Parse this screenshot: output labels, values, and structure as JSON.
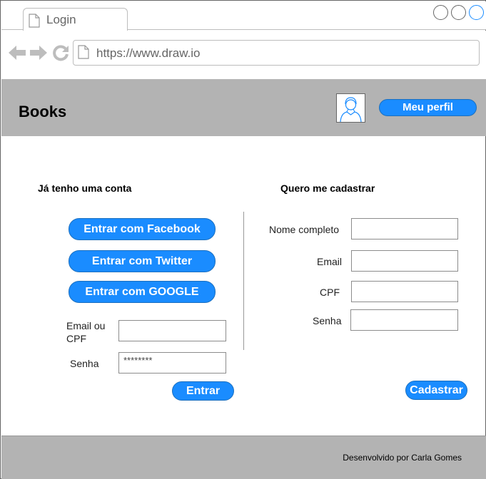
{
  "browser": {
    "tab_title": "Login",
    "url": "https://www.draw.io",
    "nav_icons": [
      "back-arrow-icon",
      "forward-arrow-icon",
      "reload-icon"
    ]
  },
  "header": {
    "brand": "Books",
    "profile_button": "Meu perfil"
  },
  "login": {
    "title": "Já tenho uma conta",
    "facebook_button": "Entrar com Facebook",
    "twitter_button": "Entrar com Twitter",
    "google_button": "Entrar com GOOGLE",
    "email_label_line1": "Email ou",
    "email_label_line2": "CPF",
    "email_value": "",
    "password_label": "Senha",
    "password_value": "********",
    "submit_button": "Entrar"
  },
  "register": {
    "title": "Quero me cadastrar",
    "name_label": "Nome completo",
    "email_label": "Email",
    "cpf_label": "CPF",
    "password_label": "Senha",
    "submit_button": "Cadastrar"
  },
  "footer": {
    "text": "Desenvolvido por  Carla Gomes"
  },
  "colors": {
    "accent": "#1a8cff",
    "header_bg": "#b3b3b3"
  }
}
